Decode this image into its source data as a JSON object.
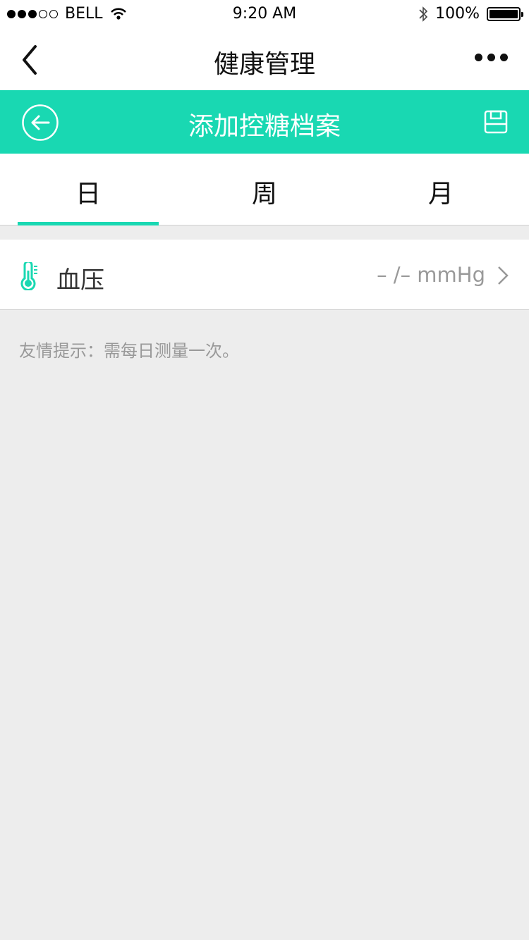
{
  "status_bar": {
    "carrier": "BELL",
    "time": "9:20 AM",
    "battery": "100%",
    "signal_full": 3,
    "signal_total": 5
  },
  "nav": {
    "title": "健康管理"
  },
  "header": {
    "title": "添加控糖档案",
    "accent_color": "#19d8b2"
  },
  "tabs": [
    {
      "label": "日",
      "selected": true
    },
    {
      "label": "周",
      "selected": false
    },
    {
      "label": "月",
      "selected": false
    }
  ],
  "record_row": {
    "label": "血压",
    "value": "– /– mmHg",
    "icon": "thermometer-icon"
  },
  "tip": "友情提示：需每日测量一次。"
}
